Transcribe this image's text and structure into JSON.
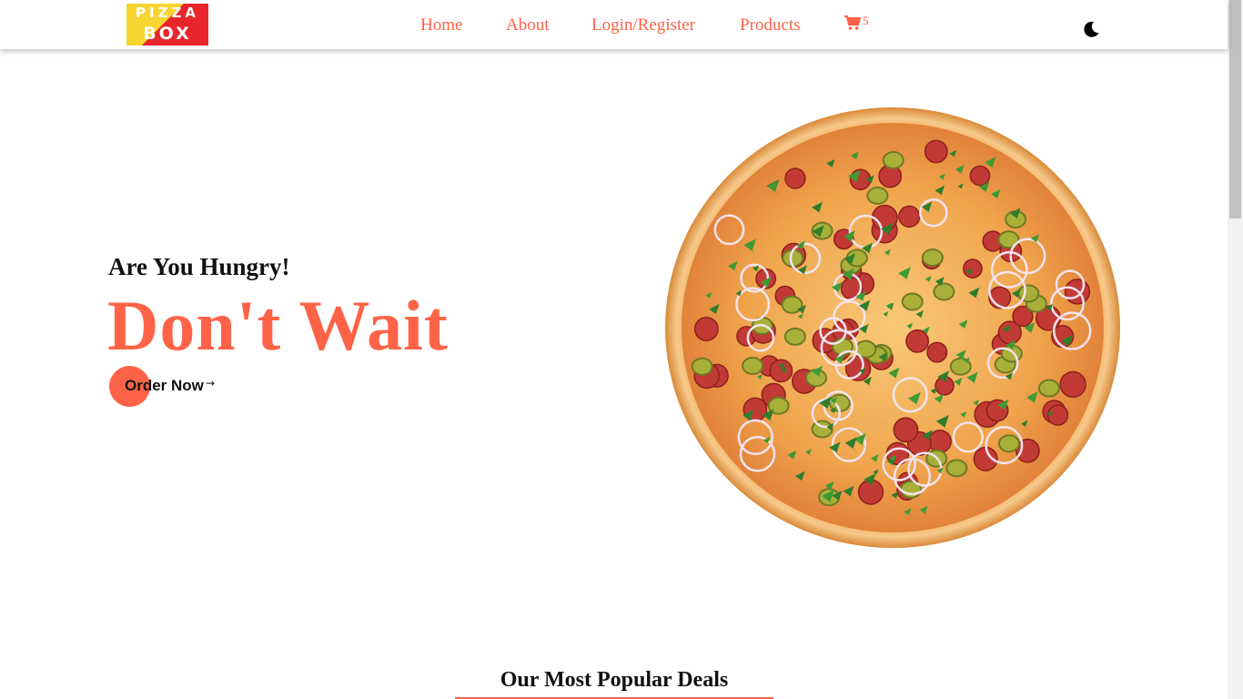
{
  "header": {
    "logo": {
      "line1": "PIZZA",
      "line2": "BOX"
    },
    "nav": [
      {
        "label": "Home"
      },
      {
        "label": "About"
      },
      {
        "label": "Login/Register"
      },
      {
        "label": "Products"
      }
    ],
    "cart": {
      "icon": "cart-icon",
      "count": "5"
    },
    "theme_toggle": {
      "icon": "moon-icon"
    }
  },
  "hero": {
    "subtitle": "Are You Hungry!",
    "title": "Don't Wait",
    "cta_label": "Order Now",
    "cta_icon": "arrow-right-icon",
    "image": "pizza-image"
  },
  "section": {
    "title": "Our Most Popular Deals"
  },
  "colors": {
    "accent": "#ff6347",
    "text": "#111111",
    "background": "#ffffff"
  }
}
